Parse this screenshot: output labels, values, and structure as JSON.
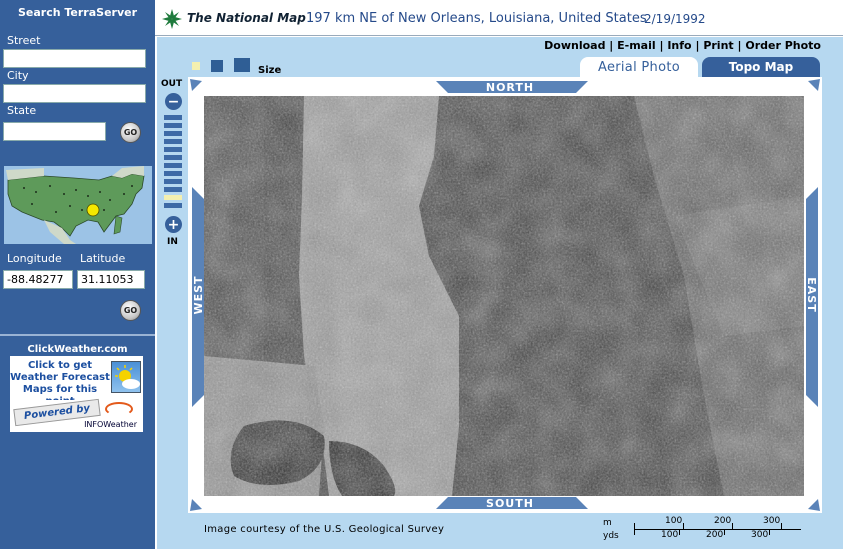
{
  "sidebar": {
    "title": "Search TerraServer",
    "street_label": "Street",
    "street_value": "",
    "city_label": "City",
    "city_value": "",
    "state_label": "State",
    "state_value": "",
    "go_label": "GO",
    "longitude_label": "Longitude",
    "latitude_label": "Latitude",
    "longitude_value": "-88.48277",
    "latitude_value": "31.11053",
    "clickweather_title": "ClickWeather.com",
    "weather_lines": [
      "Click to get",
      "Weather Forecast",
      "Maps for this point"
    ],
    "powered_by": "Powered by",
    "infoweather": "INFOWeather"
  },
  "header": {
    "brand": "The National Map",
    "location": "197 km NE of New Orleans, Louisiana, United States",
    "date": "2/19/1992"
  },
  "toolbar": {
    "download": "Download",
    "email": "E-mail",
    "info": "Info",
    "print": "Print",
    "order_photo": "Order Photo",
    "separator": " | ",
    "size_label": "Size"
  },
  "tabs": {
    "aerial": "Aerial Photo",
    "topo": "Topo Map"
  },
  "zoom": {
    "out_label": "OUT",
    "in_label": "IN",
    "plus": "+",
    "minus": "−"
  },
  "compass": {
    "north": "NORTH",
    "south": "SOUTH",
    "east": "EAST",
    "west": "WEST"
  },
  "footer": {
    "credit": "Image courtesy of the U.S. Geological Survey",
    "scale_units_top": "m",
    "scale_units_bottom": "yds",
    "scale_top": [
      "100",
      "200",
      "300"
    ],
    "scale_bottom": [
      "100",
      "200",
      "300"
    ]
  },
  "colors": {
    "sidebar_bg": "#36609b",
    "main_bg": "#b6d8f0",
    "accent": "#36609b"
  }
}
